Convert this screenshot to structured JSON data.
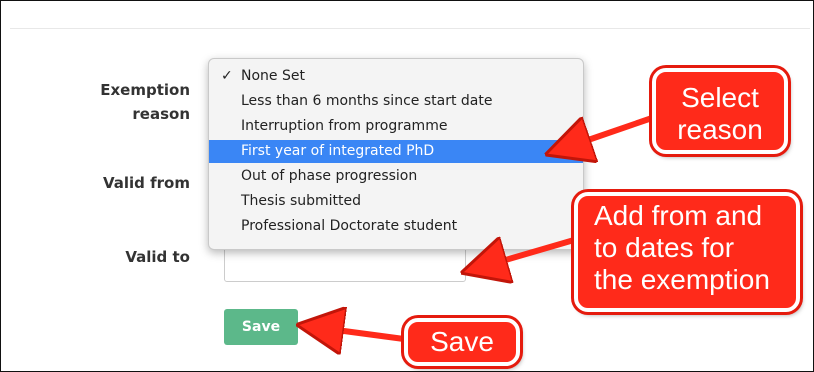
{
  "form": {
    "exemption_label_line1": "Exemption",
    "exemption_label_line2": "reason",
    "valid_from_label": "Valid from",
    "valid_to_label": "Valid to",
    "valid_to_value": "",
    "save_label": "Save"
  },
  "dropdown": {
    "check_mark": "✓",
    "options": [
      {
        "label": "None Set",
        "checked": true,
        "highlighted": false
      },
      {
        "label": "Less than 6 months since start date",
        "checked": false,
        "highlighted": false
      },
      {
        "label": "Interruption from programme",
        "checked": false,
        "highlighted": false
      },
      {
        "label": "First year of integrated PhD",
        "checked": false,
        "highlighted": true
      },
      {
        "label": "Out of phase progression",
        "checked": false,
        "highlighted": false
      },
      {
        "label": "Thesis submitted",
        "checked": false,
        "highlighted": false
      },
      {
        "label": "Professional Doctorate student",
        "checked": false,
        "highlighted": false
      }
    ]
  },
  "annotations": {
    "select_reason": [
      "Select",
      "reason"
    ],
    "add_dates": [
      "Add from and",
      "to dates for",
      "the exemption"
    ],
    "save": [
      "Save"
    ]
  },
  "colors": {
    "highlight": "#3a86f5",
    "save_button": "#5cb88a",
    "callout": "#ff2a1a"
  }
}
